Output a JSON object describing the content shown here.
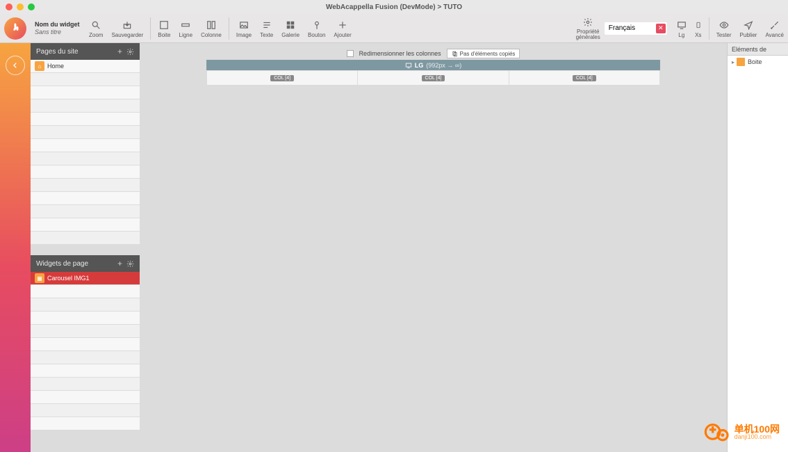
{
  "window_title": "WebAcappella Fusion (DevMode) > TUTO",
  "widget_name": {
    "label": "Nom du widget",
    "value": "Sans titre"
  },
  "toolbar": {
    "zoom": "Zoom",
    "save": "Sauvegarder",
    "box": "Boite",
    "row": "Ligne",
    "column": "Colonne",
    "image": "Image",
    "text": "Texte",
    "gallery": "Galerie",
    "button": "Bouton",
    "add": "Ajouter",
    "props": "Propriété\ngénérales",
    "lg": "Lg",
    "xs": "Xs",
    "test": "Tester",
    "publish": "Publier",
    "advanced": "Avancé"
  },
  "language": "Français",
  "sidebar": {
    "pages_title": "Pages du site",
    "widgets_title": "Widgets de page",
    "home_label": "Home",
    "carousel_label": "Carousel IMG1"
  },
  "canvas": {
    "resize_label": "Redimensionner les colonnes",
    "clipboard": "Pas d'éléments copiés",
    "breakpoint_name": "LG",
    "breakpoint_range": "(992px → ∞)",
    "col_label": "COL [4]"
  },
  "right_panel": {
    "title": "Eléments de",
    "item1": "Boite"
  },
  "watermark": {
    "line1": "单机100网",
    "line2": "danji100.com"
  }
}
